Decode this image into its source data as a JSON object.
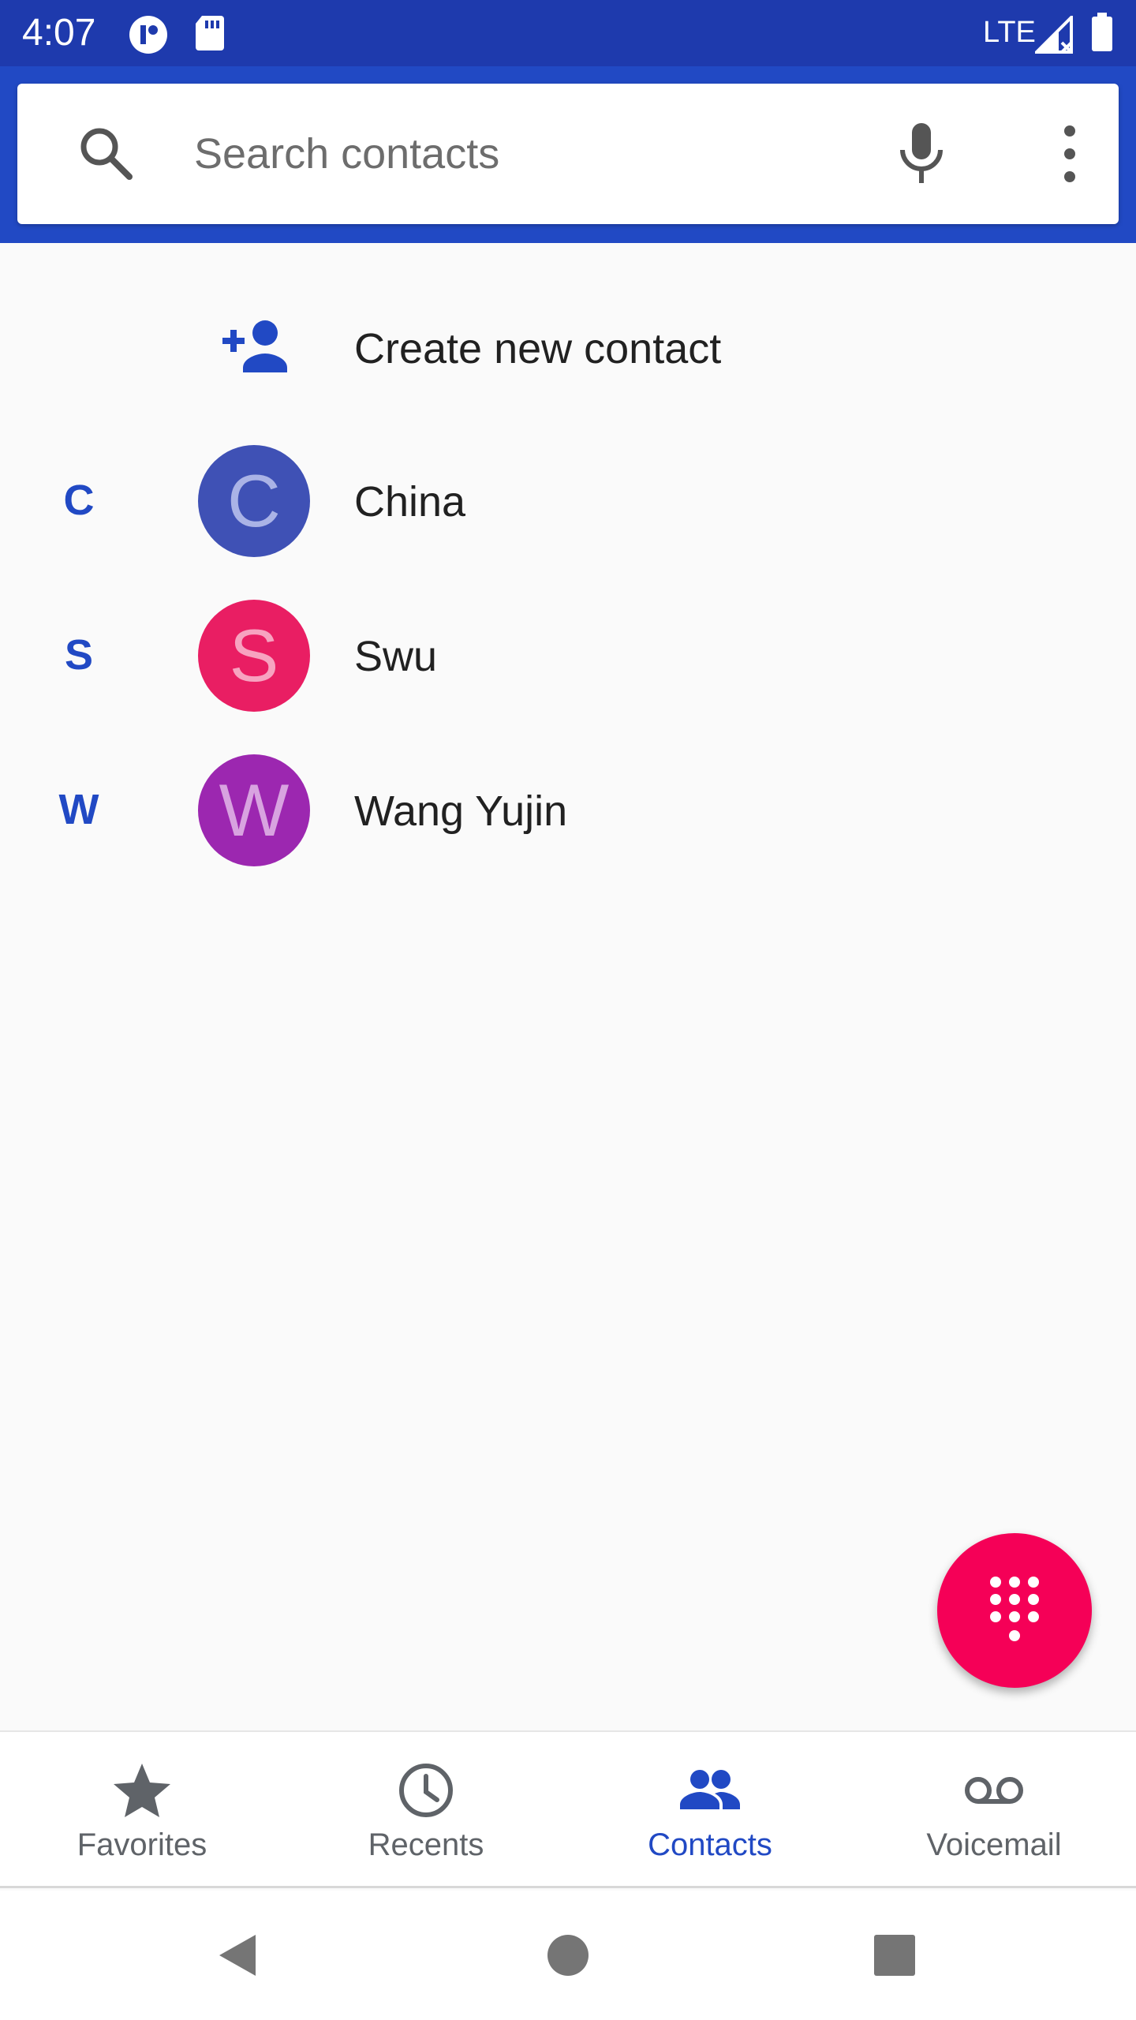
{
  "status_bar": {
    "time": "4:07",
    "network": "LTE",
    "icons": [
      "app-notification-icon",
      "sd-card-icon",
      "signal-icon",
      "battery-icon"
    ],
    "background_color": "#1e3aad"
  },
  "search": {
    "placeholder": "Search contacts",
    "value": "",
    "icons": [
      "search-icon",
      "mic-icon",
      "more-options-icon"
    ],
    "header_color": "#2149c4"
  },
  "create_contact": {
    "label": "Create new contact",
    "icon": "add-person-icon"
  },
  "contacts": [
    {
      "section": "C",
      "initial": "C",
      "name": "China",
      "avatar_bg": "#3f51b5",
      "avatar_fg": "#aab3e6"
    },
    {
      "section": "S",
      "initial": "S",
      "name": "Swu",
      "avatar_bg": "#e91e63",
      "avatar_fg": "#f7a3c0"
    },
    {
      "section": "W",
      "initial": "W",
      "name": "Wang Yujin",
      "avatar_bg": "#9c27b0",
      "avatar_fg": "#d8a3e0"
    }
  ],
  "fab": {
    "icon": "dialpad-icon",
    "color": "#f50057"
  },
  "bottom_nav": {
    "items": [
      {
        "label": "Favorites",
        "icon": "star-icon",
        "active": false
      },
      {
        "label": "Recents",
        "icon": "clock-icon",
        "active": false
      },
      {
        "label": "Contacts",
        "icon": "people-icon",
        "active": true
      },
      {
        "label": "Voicemail",
        "icon": "voicemail-icon",
        "active": false
      }
    ],
    "active_color": "#2149c4",
    "inactive_color": "#5f6368"
  },
  "system_nav": {
    "buttons": [
      "back-icon",
      "home-icon",
      "recents-square-icon"
    ]
  }
}
